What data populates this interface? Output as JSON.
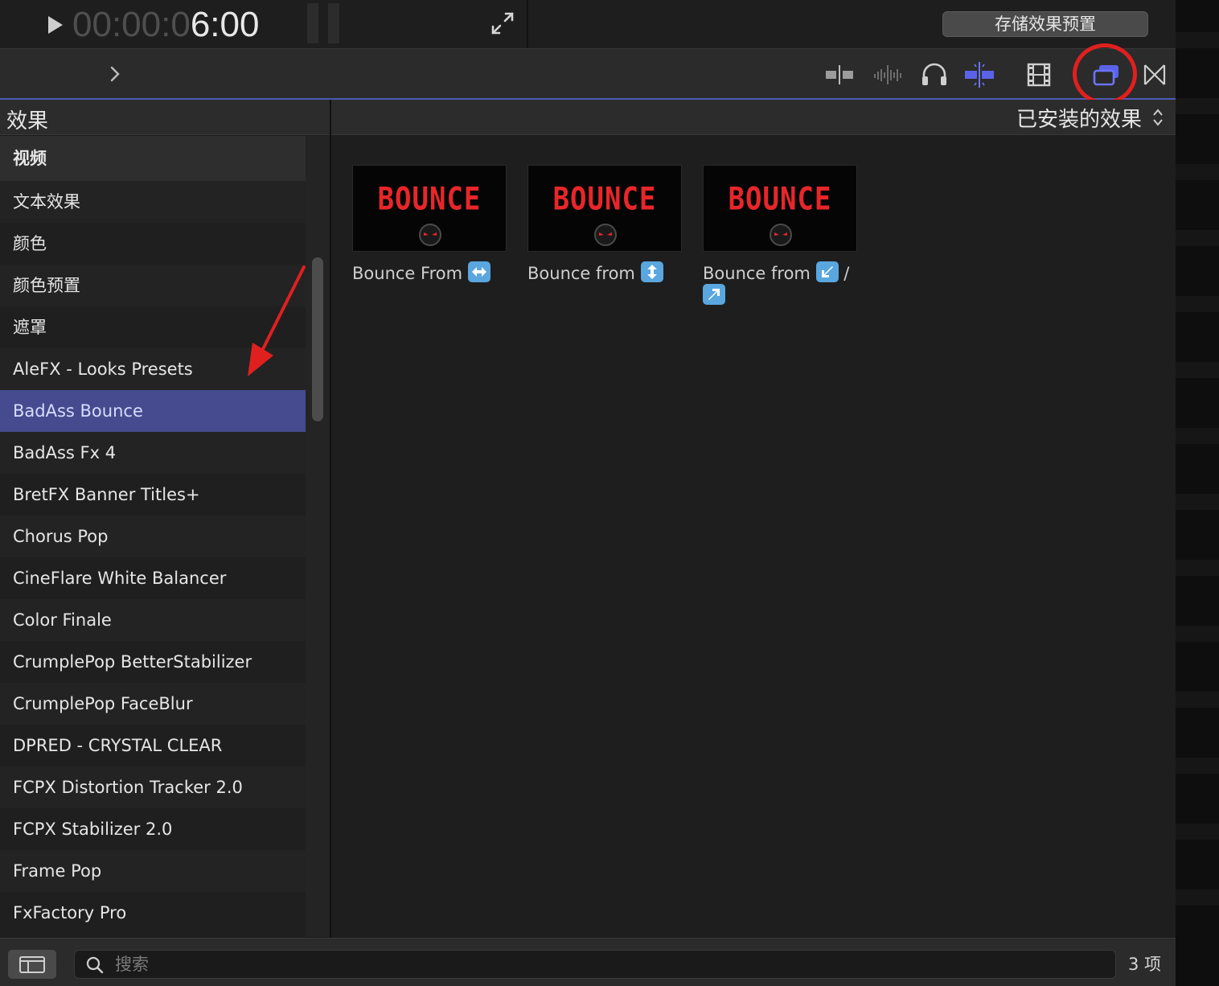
{
  "timecode": {
    "dim": "00:00:0",
    "lit": "6:00"
  },
  "toolbar": {
    "save_preset_label": "存储效果预置"
  },
  "colors": {
    "accent": "#4d59b4",
    "selection": "#454b8e",
    "thumb_text": "#e8262a",
    "callout": "#e0201f"
  },
  "sidebar": {
    "title": "效果",
    "items": [
      {
        "label": "视频"
      },
      {
        "label": "文本效果"
      },
      {
        "label": "颜色"
      },
      {
        "label": "颜色预置"
      },
      {
        "label": "遮罩"
      },
      {
        "label": "AleFX - Looks Presets"
      },
      {
        "label": "BadAss Bounce"
      },
      {
        "label": "BadAss Fx 4"
      },
      {
        "label": "BretFX Banner Titles+"
      },
      {
        "label": "Chorus Pop"
      },
      {
        "label": "CineFlare White Balancer"
      },
      {
        "label": "Color Finale"
      },
      {
        "label": "CrumplePop BetterStabilizer"
      },
      {
        "label": "CrumplePop FaceBlur"
      },
      {
        "label": "DPRED - CRYSTAL CLEAR"
      },
      {
        "label": "FCPX Distortion Tracker 2.0"
      },
      {
        "label": "FCPX Stabilizer 2.0"
      },
      {
        "label": "Frame Pop"
      },
      {
        "label": "FxFactory Pro"
      }
    ]
  },
  "content": {
    "filter_label": "已安装的效果",
    "tiles": [
      {
        "thumb_text": "BOUNCE",
        "caption": "Bounce From",
        "icon": "left-right-arrow-icon"
      },
      {
        "thumb_text": "BOUNCE",
        "caption": "Bounce from",
        "icon": "up-down-arrow-icon"
      },
      {
        "thumb_text": "BOUNCE",
        "caption": "Bounce from",
        "icon": "down-left-arrow-icon",
        "separator": "/",
        "icon2": "up-right-arrow-icon"
      }
    ]
  },
  "footer": {
    "search_placeholder": "搜索",
    "search_value": "",
    "item_count": "3 项"
  }
}
